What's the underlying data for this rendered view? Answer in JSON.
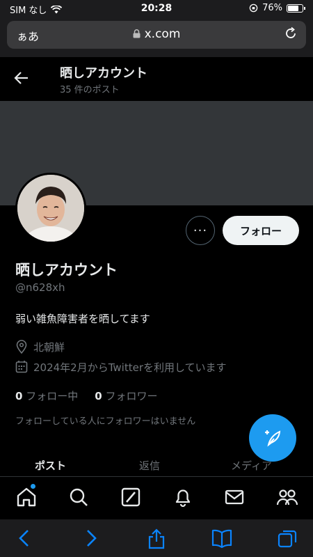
{
  "status": {
    "carrier": "SIM なし",
    "time": "20:28",
    "battery": "76%"
  },
  "browser": {
    "aa_label": "ぁあ",
    "url": "x.com"
  },
  "header": {
    "title": "晒しアカウント",
    "post_count": "35 件のポスト"
  },
  "profile": {
    "more_label": "···",
    "follow_label": "フォロー",
    "name": "晒しアカウント",
    "handle": "@n628xh",
    "bio": "弱い雑魚障害者を晒してます",
    "location": "北朝鮮",
    "joined": "2024年2月からTwitterを利用しています",
    "following_count": "0",
    "following_label": "フォロー中",
    "followers_count": "0",
    "followers_label": "フォロワー",
    "mutual_note": "フォローしている人にフォロワーはいません"
  },
  "tabs": [
    {
      "label": "ポスト"
    },
    {
      "label": "返信"
    },
    {
      "label": "メディア"
    }
  ],
  "colors": {
    "accent": "#1d9bf0",
    "background": "#000000",
    "muted": "#71767b"
  },
  "icons": {
    "nav": [
      "home-icon",
      "search-icon",
      "grok-icon",
      "bell-icon",
      "mail-icon",
      "communities-icon"
    ],
    "safari": [
      "back-icon",
      "forward-icon",
      "share-icon",
      "bookmarks-icon",
      "tabs-icon"
    ]
  }
}
